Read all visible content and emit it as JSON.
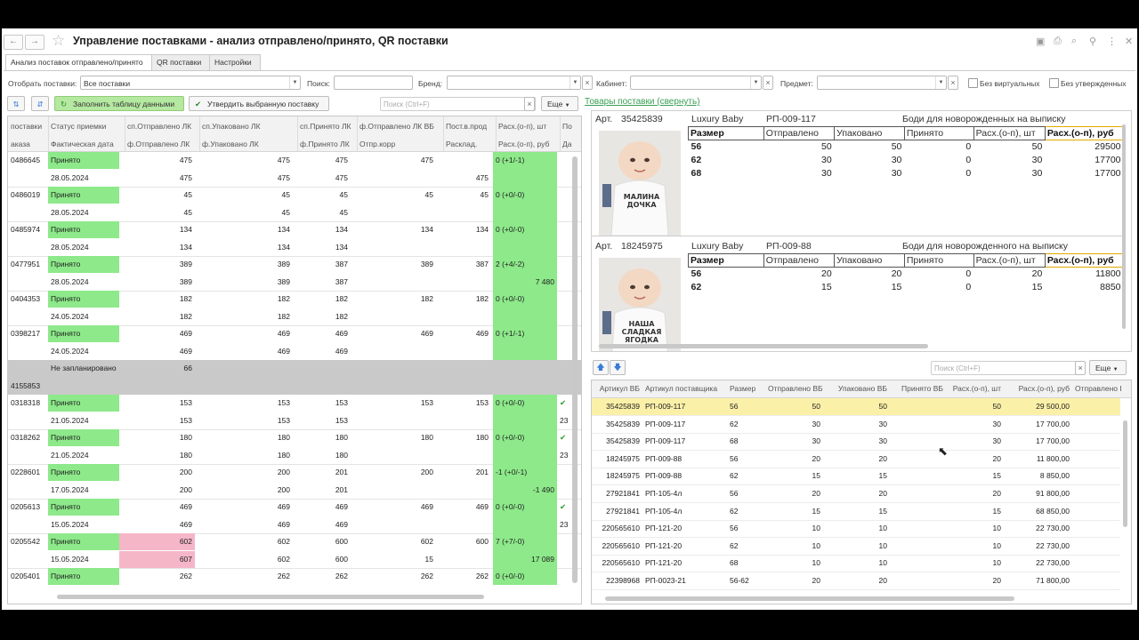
{
  "window": {
    "title": "Управление поставками - анализ отправлено/принято, QR поставки",
    "nav_back": "←",
    "nav_forward": "→"
  },
  "tabs": [
    {
      "label": "Анализ поставок отправлено/принято",
      "active": true
    },
    {
      "label": "QR поставки",
      "active": false
    },
    {
      "label": "Настройки",
      "active": false
    }
  ],
  "filters": {
    "show_label": "Отобрать поставки:",
    "show_value": "Все поставки",
    "search_label": "Поиск:",
    "search_value": "",
    "brand_label": "Бренд:",
    "brand_value": "",
    "cabinet_label": "Кабинет:",
    "cabinet_value": "",
    "subject_label": "Предмет:",
    "subject_value": "",
    "virtual_label": "Без виртуальных",
    "unapproved_label": "Без утвержденных"
  },
  "toolbar": {
    "fill_button": "Заполнить таблицу данными",
    "approve_button": "Утвердить выбранную поставку",
    "search_placeholder": "Поиск (Ctrl+F)",
    "more_button": "Еще"
  },
  "left_grid": {
    "header_top": [
      "поставки",
      "Статус приемки",
      "сп.Отправлено ЛК",
      "сп.Упаковано ЛК",
      "сп.Принято ЛК",
      "ф.Отправлено ЛК ВБ",
      "Пост.в.прод",
      "Расх.(о-п), шт",
      "По"
    ],
    "header_bottom": [
      "аказа",
      "Фактическая дата",
      "ф.Отправлено ЛК",
      "ф.Упаковано ЛК",
      "ф.Принято ЛК",
      "Отпр.корр",
      "Расклад.",
      "Расх.(о-п), руб",
      "Да"
    ],
    "rows": [
      {
        "id": "0486645",
        "status": "Принято",
        "sent": "475",
        "packed": "475",
        "accepted": "475",
        "sent_vb": "475",
        "in_sale": "",
        "diff": "0 (+1/-1)",
        "date": "28.05.2024",
        "f_sent": "475",
        "f_packed": "475",
        "f_accepted": "475",
        "corr": "",
        "layout": "475",
        "diff_rub": ""
      },
      {
        "id": "0486019",
        "status": "Принято",
        "sent": "45",
        "packed": "45",
        "accepted": "45",
        "sent_vb": "45",
        "in_sale": "45",
        "diff": "0 (+0/-0)",
        "date": "28.05.2024",
        "f_sent": "45",
        "f_packed": "45",
        "f_accepted": "45",
        "corr": "",
        "layout": "",
        "diff_rub": ""
      },
      {
        "id": "0485974",
        "status": "Принято",
        "sent": "134",
        "packed": "134",
        "accepted": "134",
        "sent_vb": "134",
        "in_sale": "134",
        "diff": "0 (+0/-0)",
        "date": "28.05.2024",
        "f_sent": "134",
        "f_packed": "134",
        "f_accepted": "134",
        "corr": "",
        "layout": "",
        "diff_rub": ""
      },
      {
        "id": "0477951",
        "status": "Принято",
        "sent": "389",
        "packed": "389",
        "accepted": "387",
        "sent_vb": "389",
        "in_sale": "387",
        "diff": "2 (+4/-2)",
        "date": "28.05.2024",
        "f_sent": "389",
        "f_packed": "389",
        "f_accepted": "387",
        "corr": "",
        "layout": "",
        "diff_rub": "7 480"
      },
      {
        "id": "0404353",
        "status": "Принято",
        "sent": "182",
        "packed": "182",
        "accepted": "182",
        "sent_vb": "182",
        "in_sale": "182",
        "diff": "0 (+0/-0)",
        "date": "24.05.2024",
        "f_sent": "182",
        "f_packed": "182",
        "f_accepted": "182",
        "corr": "",
        "layout": "",
        "diff_rub": ""
      },
      {
        "id": "0398217",
        "status": "Принято",
        "sent": "469",
        "packed": "469",
        "accepted": "469",
        "sent_vb": "469",
        "in_sale": "469",
        "diff": "0 (+1/-1)",
        "date": "24.05.2024",
        "f_sent": "469",
        "f_packed": "469",
        "f_accepted": "469",
        "corr": "",
        "layout": "",
        "diff_rub": ""
      }
    ],
    "unplanned": {
      "status": "Не запланировано",
      "sent": "66",
      "id": "4155853"
    },
    "rows2": [
      {
        "id": "0318318",
        "status": "Принято",
        "sent": "153",
        "packed": "153",
        "accepted": "153",
        "sent_vb": "153",
        "in_sale": "153",
        "diff": "0 (+0/-0)",
        "date": "21.05.2024",
        "f_sent": "153",
        "f_packed": "153",
        "f_accepted": "153",
        "corr": "",
        "layout": "",
        "diff_rub": "",
        "extra": "23"
      },
      {
        "id": "0318262",
        "status": "Принято",
        "sent": "180",
        "packed": "180",
        "accepted": "180",
        "sent_vb": "180",
        "in_sale": "180",
        "diff": "0 (+0/-0)",
        "date": "21.05.2024",
        "f_sent": "180",
        "f_packed": "180",
        "f_accepted": "180",
        "corr": "",
        "layout": "",
        "diff_rub": "",
        "extra": "23"
      },
      {
        "id": "0228601",
        "status": "Принято",
        "sent": "200",
        "packed": "200",
        "accepted": "201",
        "sent_vb": "200",
        "in_sale": "201",
        "diff": "-1 (+0/-1)",
        "date": "17.05.2024",
        "f_sent": "200",
        "f_packed": "200",
        "f_accepted": "201",
        "corr": "",
        "layout": "",
        "diff_rub": "-1 490",
        "extra": ""
      },
      {
        "id": "0205613",
        "status": "Принято",
        "sent": "469",
        "packed": "469",
        "accepted": "469",
        "sent_vb": "469",
        "in_sale": "469",
        "diff": "0 (+0/-0)",
        "date": "15.05.2024",
        "f_sent": "469",
        "f_packed": "469",
        "f_accepted": "469",
        "corr": "",
        "layout": "",
        "diff_rub": "",
        "extra": "23"
      },
      {
        "id": "0205542",
        "status": "Принято",
        "sent": "602",
        "packed": "602",
        "accepted": "600",
        "sent_vb": "602",
        "in_sale": "600",
        "diff": "7 (+7/-0)",
        "date": "15.05.2024",
        "f_sent": "607",
        "f_packed": "602",
        "f_accepted": "600",
        "corr": "15",
        "layout": "",
        "diff_rub": "17 089",
        "extra": ""
      }
    ],
    "last_row": {
      "id": "0205401",
      "status": "Принято",
      "sent": "262",
      "packed": "262",
      "accepted": "262",
      "sent_vb": "262",
      "in_sale": "262",
      "diff": "0 (+0/-0)"
    }
  },
  "goods_link": "Товары поставки (свернуть)",
  "cards": [
    {
      "art_label": "Арт.",
      "art": "35425839",
      "brand": "Luxury Baby",
      "code": "РП-009-117",
      "name": "Боди для новорожденных на выписку",
      "headers": [
        "Размер",
        "Отправлено",
        "Упаковано",
        "Принято",
        "Расх.(о-п), шт",
        "Расх.(о-п), руб"
      ],
      "rows": [
        [
          "56",
          "50",
          "50",
          "0",
          "50",
          "29500"
        ],
        [
          "62",
          "30",
          "30",
          "0",
          "30",
          "17700"
        ],
        [
          "68",
          "30",
          "30",
          "0",
          "30",
          "17700"
        ]
      ],
      "photo_text": "МАЛИНА ДОЧКА"
    },
    {
      "art_label": "Арт.",
      "art": "18245975",
      "brand": "Luxury Baby",
      "code": "РП-009-88",
      "name": "Боди для новорожденного на выписку",
      "headers": [
        "Размер",
        "Отправлено",
        "Упаковано",
        "Принято",
        "Расх.(о-п), шт",
        "Расх.(о-п), руб"
      ],
      "rows": [
        [
          "56",
          "20",
          "20",
          "0",
          "20",
          "11800"
        ],
        [
          "62",
          "15",
          "15",
          "0",
          "15",
          "8850"
        ]
      ],
      "photo_text": "НАША СЛАДКАЯ ЯГОДКА"
    }
  ],
  "bottom_toolbar": {
    "search_placeholder": "Поиск (Ctrl+F)",
    "more_button": "Еще"
  },
  "bottom_grid": {
    "headers": [
      "Артикул ВБ",
      "Артикул поставщика",
      "Размер",
      "Отправлено ВБ",
      "Упаковано ВБ",
      "Принято ВБ",
      "Расх.(о-п), шт",
      "Расх.(о-п), руб",
      "Отправлено I"
    ],
    "rows": [
      [
        "35425839",
        "РП-009-117",
        "56",
        "50",
        "50",
        "",
        "50",
        "29 500,00"
      ],
      [
        "35425839",
        "РП-009-117",
        "62",
        "30",
        "30",
        "",
        "30",
        "17 700,00"
      ],
      [
        "35425839",
        "РП-009-117",
        "68",
        "30",
        "30",
        "",
        "30",
        "17 700,00"
      ],
      [
        "18245975",
        "РП-009-88",
        "56",
        "20",
        "20",
        "",
        "20",
        "11 800,00"
      ],
      [
        "18245975",
        "РП-009-88",
        "62",
        "15",
        "15",
        "",
        "15",
        "8 850,00"
      ],
      [
        "27921841",
        "РП-105-4л",
        "56",
        "20",
        "20",
        "",
        "20",
        "91 800,00"
      ],
      [
        "27921841",
        "РП-105-4л",
        "62",
        "15",
        "15",
        "",
        "15",
        "68 850,00"
      ],
      [
        "220565610",
        "РП-121-20",
        "56",
        "10",
        "10",
        "",
        "10",
        "22 730,00"
      ],
      [
        "220565610",
        "РП-121-20",
        "62",
        "10",
        "10",
        "",
        "10",
        "22 730,00"
      ],
      [
        "220565610",
        "РП-121-20",
        "68",
        "10",
        "10",
        "",
        "10",
        "22 730,00"
      ],
      [
        "22398968",
        "РП-0023-21",
        "56-62",
        "20",
        "20",
        "",
        "20",
        "71 800,00"
      ]
    ]
  }
}
